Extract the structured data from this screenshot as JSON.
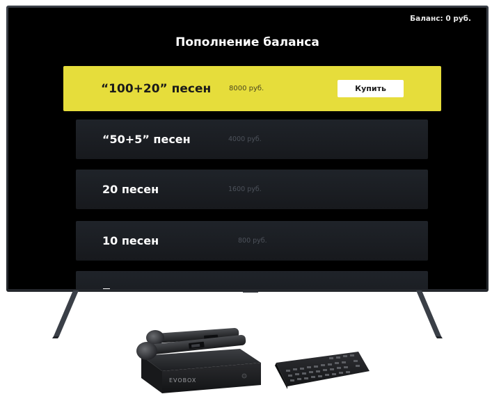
{
  "screen": {
    "balance": "Баланс: 0 руб.",
    "title": "Пополнение баланса",
    "packages": [
      {
        "name": "“100+20” песен",
        "price": "8000 руб.",
        "active": true
      },
      {
        "name": "“50+5” песен",
        "price": "4000 руб.",
        "active": false
      },
      {
        "name": "20 песен",
        "price": "1600 руб.",
        "active": false
      },
      {
        "name": "10 песен",
        "price": "800 руб.",
        "active": false
      }
    ],
    "buy_label": "Купить"
  },
  "device": {
    "box_brand": "EVOBOX"
  },
  "colors": {
    "highlight": "#e6dd3b",
    "screen_bg": "#000000",
    "row_bg": "#1c1f24"
  }
}
